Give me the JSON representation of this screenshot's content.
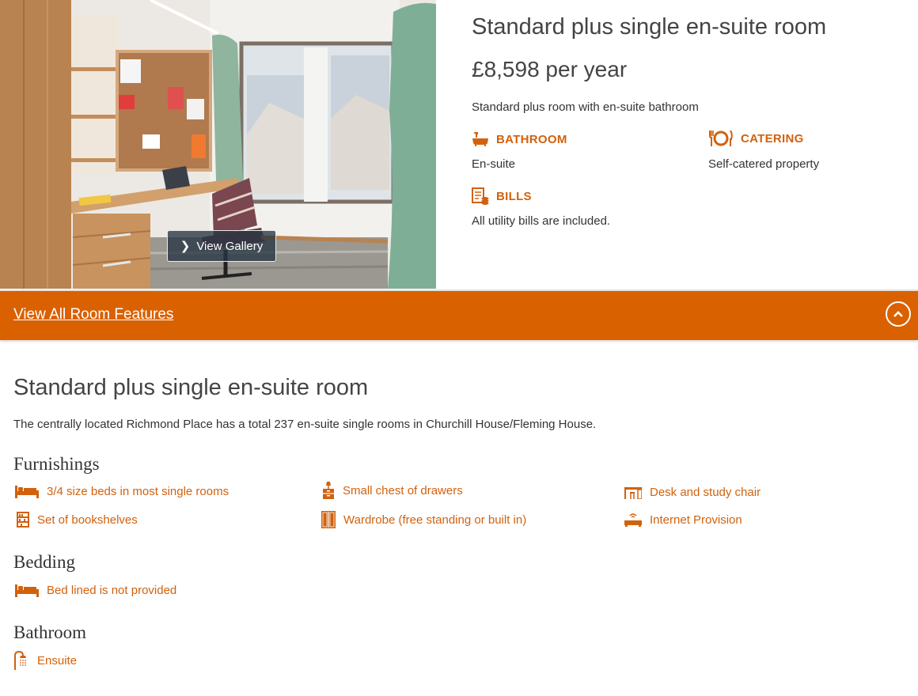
{
  "room": {
    "title": "Standard plus single en-suite room",
    "price": "£8,598 per year",
    "description": "Standard plus room with en-suite bathroom",
    "gallery_button": "View Gallery",
    "features": {
      "bathroom": {
        "label": "BATHROOM",
        "value": "En-suite",
        "icon": "bath-icon"
      },
      "catering": {
        "label": "CATERING",
        "value": "Self-catered property",
        "icon": "plate-cutlery-icon"
      },
      "bills": {
        "label": "BILLS",
        "value": "All utility bills are included.",
        "icon": "bill-coins-icon"
      }
    }
  },
  "features_bar": {
    "link_label": "View All Room Features",
    "toggle_icon": "chevron-up-circle-icon"
  },
  "detail": {
    "title": "Standard plus single en-suite room",
    "description": "The centrally located Richmond Place has a total 237 en-suite single rooms in Churchill House/Fleming House.",
    "furnishings": {
      "heading": "Furnishings",
      "items": [
        {
          "label": "3/4 size beds in most single rooms",
          "icon": "bed-icon"
        },
        {
          "label": "Small chest of drawers",
          "icon": "chest-of-drawers-icon"
        },
        {
          "label": "Desk and study chair",
          "icon": "desk-chair-icon"
        },
        {
          "label": "Set of bookshelves",
          "icon": "bookshelf-icon"
        },
        {
          "label": "Wardrobe (free standing or built in)",
          "icon": "wardrobe-icon"
        },
        {
          "label": "Internet Provision",
          "icon": "router-icon"
        }
      ]
    },
    "bedding": {
      "heading": "Bedding",
      "items": [
        {
          "label": "Bed lined is not provided",
          "icon": "bed-icon"
        }
      ]
    },
    "bathroom": {
      "heading": "Bathroom",
      "items": [
        {
          "label": "Ensuite",
          "icon": "shower-icon"
        }
      ]
    }
  },
  "colors": {
    "accent": "#d96100",
    "accent_text": "#d2610d",
    "text": "#333333"
  }
}
